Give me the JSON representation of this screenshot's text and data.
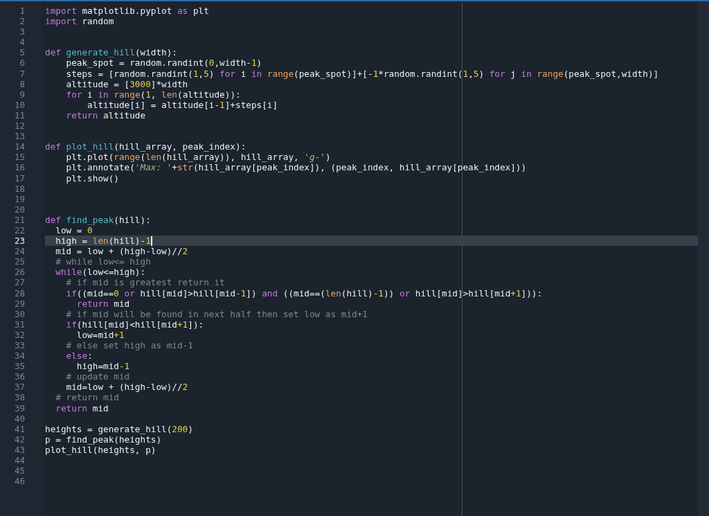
{
  "editor": {
    "lines": [
      {
        "number": "1",
        "current": false,
        "tokens": [
          {
            "kind": "keyword",
            "text": "import"
          },
          {
            "kind": "plain",
            "text": " matplotlib.pyplot "
          },
          {
            "kind": "keyword",
            "text": "as"
          },
          {
            "kind": "plain",
            "text": " plt"
          }
        ]
      },
      {
        "number": "2",
        "current": false,
        "tokens": [
          {
            "kind": "keyword",
            "text": "import"
          },
          {
            "kind": "plain",
            "text": " random"
          }
        ]
      },
      {
        "number": "3",
        "current": false
      },
      {
        "number": "4",
        "current": false
      },
      {
        "number": "5",
        "current": false,
        "tokens": [
          {
            "kind": "keyword",
            "text": "def "
          },
          {
            "kind": "name",
            "text": "generate_hill"
          },
          {
            "kind": "plain",
            "text": "(width):"
          }
        ]
      },
      {
        "number": "6",
        "current": false,
        "tokens": [
          {
            "kind": "plain",
            "text": "    peak_spot = random.randint("
          },
          {
            "kind": "number",
            "text": "0"
          },
          {
            "kind": "plain",
            "text": ",width-"
          },
          {
            "kind": "number",
            "text": "1"
          },
          {
            "kind": "plain",
            "text": ")"
          }
        ]
      },
      {
        "number": "7",
        "current": false,
        "tokens": [
          {
            "kind": "plain",
            "text": "    steps = [random.randint("
          },
          {
            "kind": "number",
            "text": "1"
          },
          {
            "kind": "plain",
            "text": ","
          },
          {
            "kind": "number",
            "text": "5"
          },
          {
            "kind": "plain",
            "text": ") "
          },
          {
            "kind": "keyword",
            "text": "for"
          },
          {
            "kind": "plain",
            "text": " i "
          },
          {
            "kind": "keyword",
            "text": "in "
          },
          {
            "kind": "builtin",
            "text": "range"
          },
          {
            "kind": "plain",
            "text": "(peak_spot)]+[-"
          },
          {
            "kind": "number",
            "text": "1"
          },
          {
            "kind": "plain",
            "text": "*random.randint("
          },
          {
            "kind": "number",
            "text": "1"
          },
          {
            "kind": "plain",
            "text": ","
          },
          {
            "kind": "number",
            "text": "5"
          },
          {
            "kind": "plain",
            "text": ") "
          },
          {
            "kind": "keyword",
            "text": "for"
          },
          {
            "kind": "plain",
            "text": " j "
          },
          {
            "kind": "keyword",
            "text": "in "
          },
          {
            "kind": "builtin",
            "text": "range"
          },
          {
            "kind": "plain",
            "text": "(peak_spot,width)]"
          }
        ]
      },
      {
        "number": "8",
        "current": false,
        "tokens": [
          {
            "kind": "plain",
            "text": "    altitude = ["
          },
          {
            "kind": "number",
            "text": "3000"
          },
          {
            "kind": "plain",
            "text": "]*width"
          }
        ]
      },
      {
        "number": "9",
        "current": false,
        "tokens": [
          {
            "kind": "keyword",
            "text": "    for"
          },
          {
            "kind": "plain",
            "text": " i "
          },
          {
            "kind": "keyword",
            "text": "in "
          },
          {
            "kind": "builtin",
            "text": "range"
          },
          {
            "kind": "plain",
            "text": "("
          },
          {
            "kind": "number",
            "text": "1"
          },
          {
            "kind": "plain",
            "text": ", "
          },
          {
            "kind": "builtin",
            "text": "len"
          },
          {
            "kind": "plain",
            "text": "(altitude)):"
          }
        ]
      },
      {
        "number": "10",
        "current": false,
        "tokens": [
          {
            "kind": "plain",
            "text": "        altitude[i] = altitude[i-"
          },
          {
            "kind": "number",
            "text": "1"
          },
          {
            "kind": "plain",
            "text": "]+steps[i]"
          }
        ]
      },
      {
        "number": "11",
        "current": false,
        "tokens": [
          {
            "kind": "keyword",
            "text": "    return"
          },
          {
            "kind": "plain",
            "text": " altitude"
          }
        ]
      },
      {
        "number": "12",
        "current": false
      },
      {
        "number": "13",
        "current": false
      },
      {
        "number": "14",
        "current": false,
        "tokens": [
          {
            "kind": "keyword",
            "text": "def "
          },
          {
            "kind": "name",
            "text": "plot_hill"
          },
          {
            "kind": "plain",
            "text": "(hill_array, peak_index):"
          }
        ]
      },
      {
        "number": "15",
        "current": false,
        "tokens": [
          {
            "kind": "plain",
            "text": "    plt.plot("
          },
          {
            "kind": "builtin",
            "text": "range"
          },
          {
            "kind": "plain",
            "text": "("
          },
          {
            "kind": "builtin",
            "text": "len"
          },
          {
            "kind": "plain",
            "text": "(hill_array)), hill_array, "
          },
          {
            "kind": "string",
            "text": "'g-'"
          },
          {
            "kind": "plain",
            "text": ")"
          }
        ]
      },
      {
        "number": "16",
        "current": false,
        "tokens": [
          {
            "kind": "plain",
            "text": "    plt.annotate("
          },
          {
            "kind": "string",
            "text": "'Max: '"
          },
          {
            "kind": "plain",
            "text": "+"
          },
          {
            "kind": "builtin",
            "text": "str"
          },
          {
            "kind": "plain",
            "text": "(hill_array[peak_index]), (peak_index, hill_array[peak_index]))"
          }
        ]
      },
      {
        "number": "17",
        "current": false,
        "tokens": [
          {
            "kind": "plain",
            "text": "    plt.show()"
          }
        ]
      },
      {
        "number": "18",
        "current": false
      },
      {
        "number": "19",
        "current": false
      },
      {
        "number": "20",
        "current": false
      },
      {
        "number": "21",
        "current": false,
        "tokens": [
          {
            "kind": "keyword",
            "text": "def "
          },
          {
            "kind": "name",
            "text": "find_peak"
          },
          {
            "kind": "plain",
            "text": "(hill):"
          }
        ]
      },
      {
        "number": "22",
        "current": false,
        "tokens": [
          {
            "kind": "plain",
            "text": "  low = "
          },
          {
            "kind": "number",
            "text": "0"
          }
        ]
      },
      {
        "number": "23",
        "current": true,
        "tokens": [
          {
            "kind": "plain",
            "text": "  high = "
          },
          {
            "kind": "builtin",
            "text": "len"
          },
          {
            "kind": "plain",
            "text": "(hill)-"
          },
          {
            "kind": "number",
            "text": "1"
          }
        ]
      },
      {
        "number": "24",
        "current": false,
        "tokens": [
          {
            "kind": "plain",
            "text": "  mid = low + (high-low)//"
          },
          {
            "kind": "number",
            "text": "2"
          }
        ]
      },
      {
        "number": "25",
        "current": false,
        "tokens": [
          {
            "kind": "comment",
            "text": "  # while low<= high"
          }
        ]
      },
      {
        "number": "26",
        "current": false,
        "tokens": [
          {
            "kind": "keyword",
            "text": "  while"
          },
          {
            "kind": "plain",
            "text": "(low<=high):"
          }
        ]
      },
      {
        "number": "27",
        "current": false,
        "tokens": [
          {
            "kind": "comment",
            "text": "    # if mid is greatest return it"
          }
        ]
      },
      {
        "number": "28",
        "current": false,
        "tokens": [
          {
            "kind": "keyword",
            "text": "    if"
          },
          {
            "kind": "plain",
            "text": "((mid=="
          },
          {
            "kind": "number",
            "text": "0"
          },
          {
            "kind": "keyword",
            "text": " or"
          },
          {
            "kind": "plain",
            "text": " hill[mid]>hill[mid"
          },
          {
            "kind": "number",
            "text": "-1"
          },
          {
            "kind": "plain",
            "text": "]) "
          },
          {
            "kind": "keyword",
            "text": "and"
          },
          {
            "kind": "plain",
            "text": " ((mid==("
          },
          {
            "kind": "builtin",
            "text": "len"
          },
          {
            "kind": "plain",
            "text": "(hill)"
          },
          {
            "kind": "number",
            "text": "-1"
          },
          {
            "kind": "plain",
            "text": ")) "
          },
          {
            "kind": "keyword",
            "text": "or"
          },
          {
            "kind": "plain",
            "text": " hill[mid]>hill[mid"
          },
          {
            "kind": "number",
            "text": "+1"
          },
          {
            "kind": "plain",
            "text": "])):"
          }
        ]
      },
      {
        "number": "29",
        "current": false,
        "tokens": [
          {
            "kind": "keyword",
            "text": "      return"
          },
          {
            "kind": "plain",
            "text": " mid"
          }
        ]
      },
      {
        "number": "30",
        "current": false,
        "tokens": [
          {
            "kind": "comment",
            "text": "    # if mid will be found in next half then set low as mid+1"
          }
        ]
      },
      {
        "number": "31",
        "current": false,
        "tokens": [
          {
            "kind": "keyword",
            "text": "    if"
          },
          {
            "kind": "plain",
            "text": "(hill[mid]<hill[mid"
          },
          {
            "kind": "number",
            "text": "+1"
          },
          {
            "kind": "plain",
            "text": "]):"
          }
        ]
      },
      {
        "number": "32",
        "current": false,
        "tokens": [
          {
            "kind": "plain",
            "text": "      low=mid"
          },
          {
            "kind": "number",
            "text": "+1"
          }
        ]
      },
      {
        "number": "33",
        "current": false,
        "tokens": [
          {
            "kind": "comment",
            "text": "    # else set high as mid-1"
          }
        ]
      },
      {
        "number": "34",
        "current": false,
        "tokens": [
          {
            "kind": "keyword",
            "text": "    else"
          },
          {
            "kind": "plain",
            "text": ":"
          }
        ]
      },
      {
        "number": "35",
        "current": false,
        "tokens": [
          {
            "kind": "plain",
            "text": "      high=mid"
          },
          {
            "kind": "number",
            "text": "-1"
          }
        ]
      },
      {
        "number": "36",
        "current": false,
        "tokens": [
          {
            "kind": "comment",
            "text": "    # update mid"
          }
        ]
      },
      {
        "number": "37",
        "current": false,
        "tokens": [
          {
            "kind": "plain",
            "text": "    mid=low + (high-low)//"
          },
          {
            "kind": "number",
            "text": "2"
          }
        ]
      },
      {
        "number": "38",
        "current": false,
        "tokens": [
          {
            "kind": "comment",
            "text": "  # return mid"
          }
        ]
      },
      {
        "number": "39",
        "current": false,
        "tokens": [
          {
            "kind": "keyword",
            "text": "  return"
          },
          {
            "kind": "plain",
            "text": " mid"
          }
        ]
      },
      {
        "number": "40",
        "current": false
      },
      {
        "number": "41",
        "current": false,
        "tokens": [
          {
            "kind": "plain",
            "text": "heights = generate_hill("
          },
          {
            "kind": "number",
            "text": "200"
          },
          {
            "kind": "plain",
            "text": ")"
          }
        ]
      },
      {
        "number": "42",
        "current": false,
        "tokens": [
          {
            "kind": "plain",
            "text": "p = find_peak(heights)"
          }
        ]
      },
      {
        "number": "43",
        "current": false,
        "tokens": [
          {
            "kind": "plain",
            "text": "plot_hill(heights, p)"
          }
        ]
      },
      {
        "number": "44",
        "current": false
      },
      {
        "number": "45",
        "current": false
      },
      {
        "number": "46",
        "current": false
      }
    ]
  }
}
